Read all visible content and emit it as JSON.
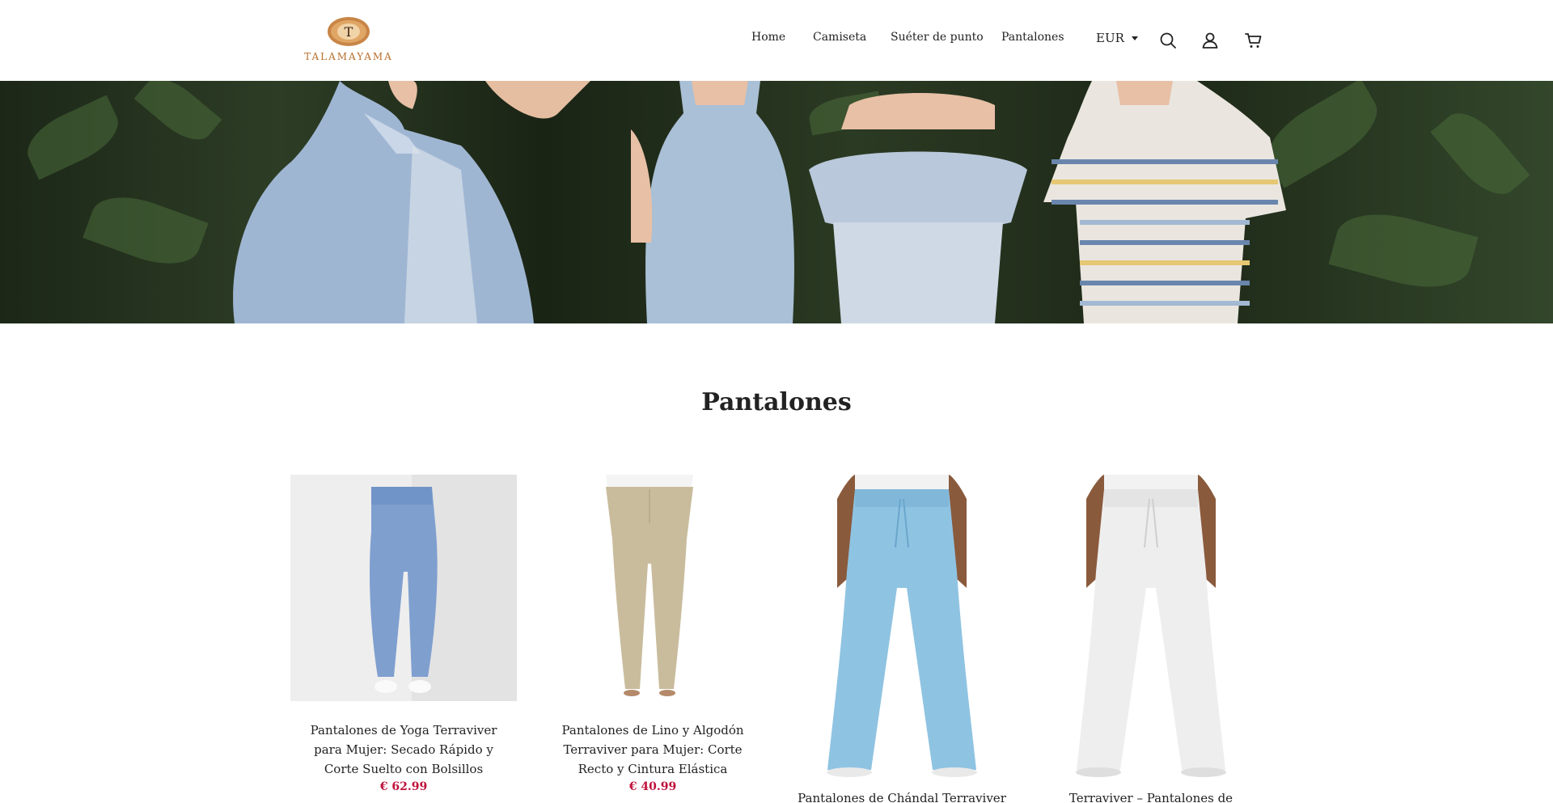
{
  "brand": {
    "name": "TALAMAYAMA",
    "monogram": "T"
  },
  "nav": {
    "items": [
      "Home",
      "Camiseta",
      "Suéter de punto",
      "Pantalones"
    ],
    "currency": "EUR"
  },
  "icons": {
    "search": "search-icon",
    "account": "user-icon",
    "cart": "cart-icon"
  },
  "colors": {
    "accent": "#c0123c",
    "brand": "#b86f2c"
  },
  "section": {
    "title": "Pantalones"
  },
  "products": [
    {
      "title": "Pantalones de Yoga Terraviver para Mujer: Secado Rápido y Corte Suelto con Bolsillos",
      "price": "€ 62.99"
    },
    {
      "title": "Pantalones de Lino y Algodón Terraviver para Mujer: Corte Recto y Cintura Elástica",
      "price": "€ 40.99"
    },
    {
      "title": "Pantalones de Chándal Terraviver",
      "price": ""
    },
    {
      "title": "Terraviver – Pantalones de Chándal de",
      "price": ""
    }
  ]
}
